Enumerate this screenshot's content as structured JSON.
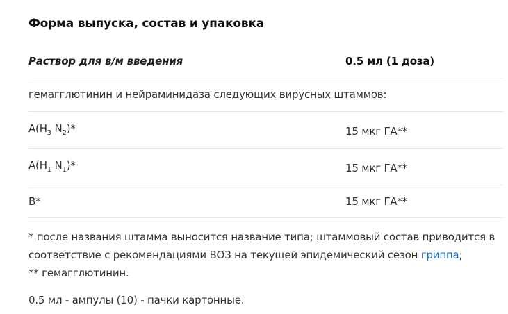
{
  "section": {
    "title": "Форма выпуска, состав и упаковка"
  },
  "composition": {
    "form_label": "Раствор для в/м введения",
    "dose_label": "0.5 мл (1 доза)",
    "full_row": "гемагглютинин и нейраминидаза следующих вирусных штаммов:",
    "strains": [
      {
        "prefix": "A(H",
        "h_sub": "3",
        "mid": " N",
        "n_sub": "2",
        "suffix": ")*",
        "amount": "15 мкг ГА**"
      },
      {
        "prefix": "A(H",
        "h_sub": "1",
        "mid": " N",
        "n_sub": "1",
        "suffix": ")*",
        "amount": "15 мкг ГА**"
      },
      {
        "name": "B*",
        "amount": "15 мкг ГА**"
      }
    ]
  },
  "notes": {
    "footnote_1_before_link": "* после названия штамма выносится название типа; штаммовый состав приводится в соответствие с рекомендациями ВОЗ на текущей эпидемический сезон ",
    "footnote_1_link": "гриппа",
    "footnote_1_after_link": ";",
    "footnote_2": "** гемагглютинин."
  },
  "packaging": "0.5 мл - ампулы (10) - пачки картонные.",
  "colors": {
    "link": "#1a73c9",
    "divider": "#e6e6e6"
  }
}
